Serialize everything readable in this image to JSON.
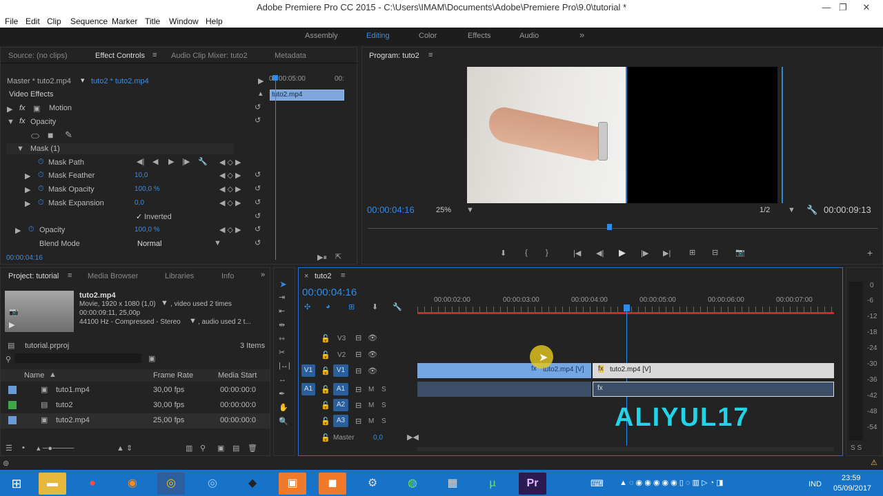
{
  "window": {
    "title": "Adobe Premiere Pro CC 2015 - C:\\Users\\IMAM\\Documents\\Adobe\\Premiere Pro\\9.0\\tutorial *"
  },
  "menu": [
    "File",
    "Edit",
    "Clip",
    "Sequence",
    "Marker",
    "Title",
    "Window",
    "Help"
  ],
  "workspaces": {
    "items": [
      "Assembly",
      "Editing",
      "Color",
      "Effects",
      "Audio"
    ],
    "active": "Editing",
    "more": "»"
  },
  "effect_panel": {
    "tabs": [
      "Source: (no clips)",
      "Effect Controls",
      "Audio Clip Mixer: tuto2",
      "Metadata"
    ],
    "master_label": "Master * tuto2.mp4",
    "clip_label": "tuto2 * tuto2.mp4",
    "ruler_time": "00:00:05:00",
    "ruler_time2": "00:",
    "clip_name": "tuto2.mp4",
    "video_effects": "Video Effects",
    "motion": "Motion",
    "opacity": "Opacity",
    "mask": "Mask (1)",
    "mask_path": "Mask Path",
    "mask_feather": "Mask Feather",
    "mask_feather_val": "10,0",
    "mask_opacity": "Mask Opacity",
    "mask_opacity_val": "100,0 %",
    "mask_expansion": "Mask Expansion",
    "mask_expansion_val": "0,0",
    "inverted": "Inverted",
    "opacity2": "Opacity",
    "opacity2_val": "100,0 %",
    "blend_mode": "Blend Mode",
    "blend_mode_val": "Normal",
    "timecode": "00:00:04:16",
    "fx": "fx"
  },
  "program": {
    "title": "Program: tuto2",
    "timecode": "00:00:04:16",
    "zoom": "25%",
    "resolution": "1/2",
    "duration": "00:00:09:13"
  },
  "project": {
    "tabs": [
      "Project: tutorial",
      "Media Browser",
      "Libraries",
      "Info"
    ],
    "clip_name": "tuto2.mp4",
    "info1": "Movie, 1920 x 1080 (1,0)",
    "info1b": ", video used 2 times",
    "info2": "00:00:09:11, 25,00p",
    "info3": "44100 Hz - Compressed - Stereo",
    "info3b": ", audio used 2 t...",
    "project_file": "tutorial.prproj",
    "items_count": "3 Items",
    "columns": [
      "Name",
      "Frame Rate",
      "Media Start"
    ],
    "rows": [
      {
        "name": "tuto1.mp4",
        "rate": "30,00 fps",
        "start": "00:00:00:0",
        "color": "#6a9bd6"
      },
      {
        "name": "tuto2",
        "rate": "30,00 fps",
        "start": "00:00:00:0",
        "color": "#3fa64a"
      },
      {
        "name": "tuto2.mp4",
        "rate": "25,00 fps",
        "start": "00:00:00:0",
        "color": "#6a9bd6"
      }
    ]
  },
  "timeline": {
    "tab": "tuto2",
    "timecode": "00:00:04:16",
    "ruler": [
      "00:00:02:00",
      "00:00:03:00",
      "00:00:04:00",
      "00:00:05:00",
      "00:00:06:00",
      "00:00:07:00"
    ],
    "tracks_video": [
      "V3",
      "V2",
      "V1"
    ],
    "tracks_audio": [
      "A1",
      "A2",
      "A3"
    ],
    "master": "Master",
    "master_val": "0,0",
    "clip1": "tuto2.mp4 [V]",
    "clip2": "tuto2.mp4 [V]",
    "mute": "M",
    "solo": "S",
    "watermark": "ALIYUL17"
  },
  "meter": {
    "labels": [
      "0",
      "-6",
      "-12",
      "-18",
      "-24",
      "-30",
      "-36",
      "-42",
      "-48",
      "-54"
    ],
    "bottom": "S S"
  },
  "taskbar": {
    "lang": "IND",
    "time": "23:59",
    "date": "05/09/2017"
  }
}
